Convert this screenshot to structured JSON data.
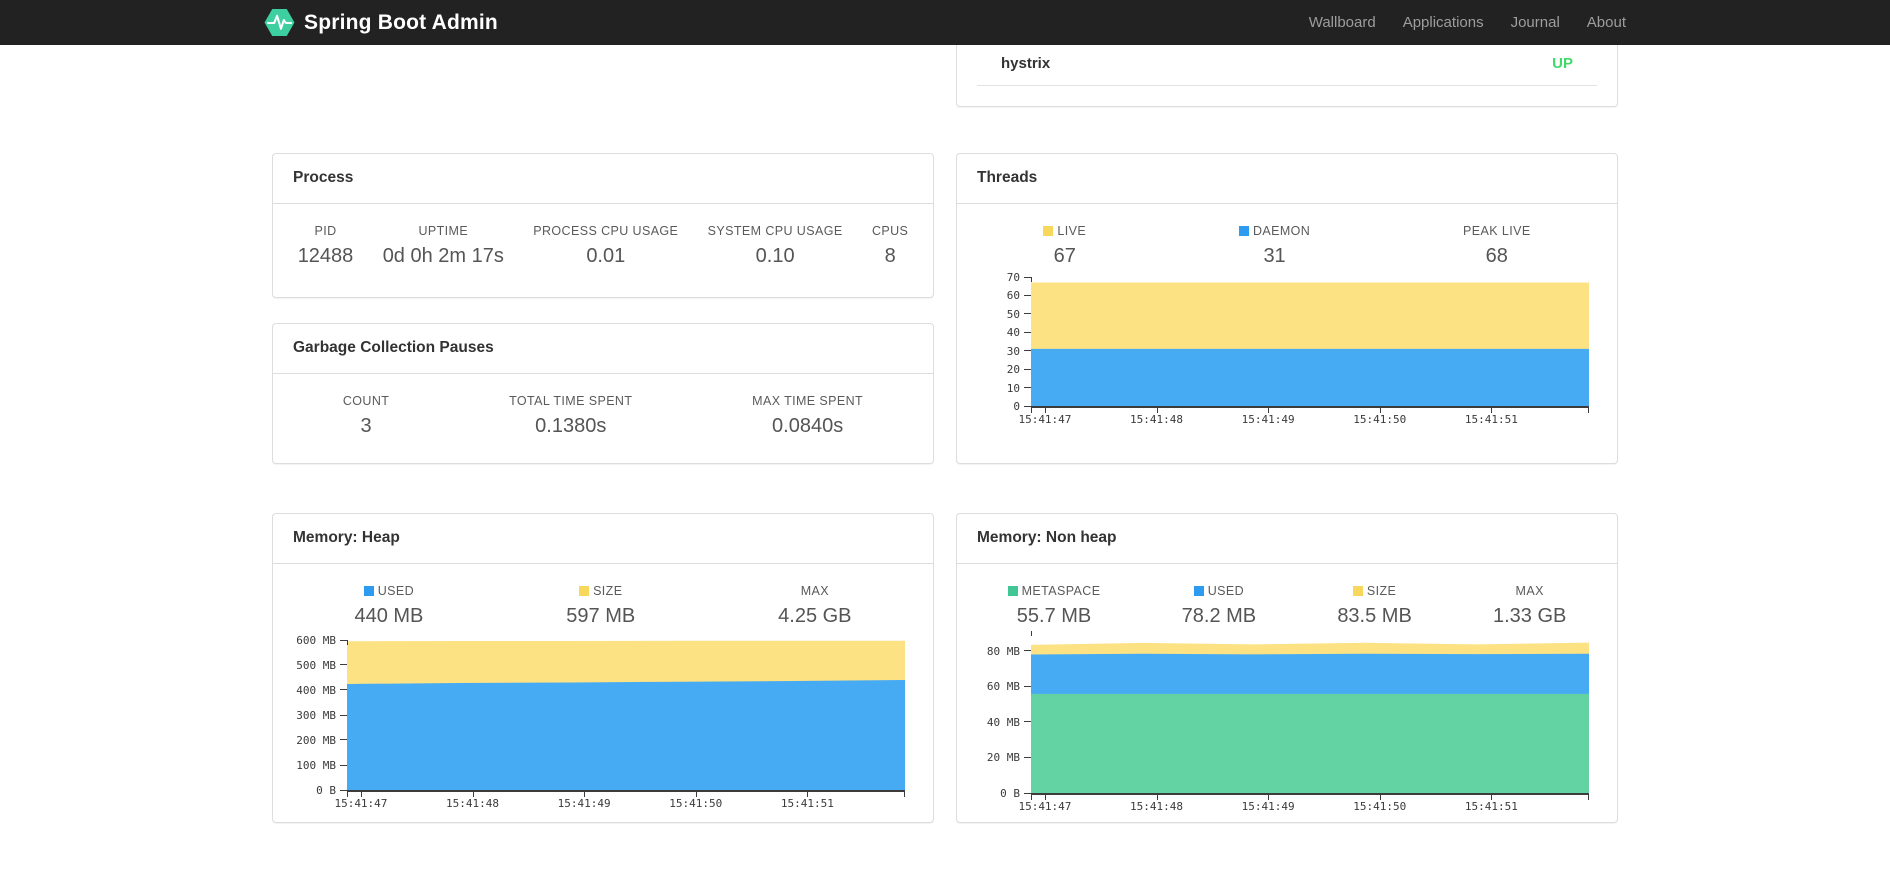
{
  "navbar": {
    "brand": "Spring Boot Admin",
    "links": [
      {
        "label": "Wallboard"
      },
      {
        "label": "Applications"
      },
      {
        "label": "Journal"
      },
      {
        "label": "About"
      }
    ]
  },
  "colors": {
    "navbar_bg": "#222222",
    "logo_green": "#3ecfa0",
    "status_up_green": "#42d96b",
    "area_yellow": "#fde284",
    "area_blue": "#47abf4",
    "area_green": "#64d3a4",
    "swatch_yellow": "#f8d75d",
    "swatch_blue": "#2d9bf0",
    "swatch_green": "#41c795",
    "panel_border": "#dddddd"
  },
  "health_panel": {
    "row_label": "hystrix",
    "row_status": "UP"
  },
  "panels": {
    "process": {
      "title": "Process",
      "stats": [
        {
          "label": "PID",
          "value": "12488"
        },
        {
          "label": "UPTIME",
          "value": "0d 0h 2m 17s"
        },
        {
          "label": "PROCESS CPU USAGE",
          "value": "0.01"
        },
        {
          "label": "SYSTEM CPU USAGE",
          "value": "0.10"
        },
        {
          "label": "CPUS",
          "value": "8"
        }
      ]
    },
    "gc": {
      "title": "Garbage Collection Pauses",
      "stats": [
        {
          "label": "COUNT",
          "value": "3"
        },
        {
          "label": "TOTAL TIME SPENT",
          "value": "0.1380s"
        },
        {
          "label": "MAX TIME SPENT",
          "value": "0.0840s"
        }
      ]
    },
    "threads": {
      "title": "Threads",
      "stats": [
        {
          "label": "LIVE",
          "value": "67",
          "swatch": "#f8d75d"
        },
        {
          "label": "DAEMON",
          "value": "31",
          "swatch": "#2d9bf0"
        },
        {
          "label": "PEAK LIVE",
          "value": "68"
        }
      ]
    },
    "heap": {
      "title": "Memory: Heap",
      "stats": [
        {
          "label": "USED",
          "value": "440 MB",
          "swatch": "#2d9bf0"
        },
        {
          "label": "SIZE",
          "value": "597 MB",
          "swatch": "#f8d75d"
        },
        {
          "label": "MAX",
          "value": "4.25 GB"
        }
      ]
    },
    "nonheap": {
      "title": "Memory: Non heap",
      "stats": [
        {
          "label": "METASPACE",
          "value": "55.7 MB",
          "swatch": "#41c795"
        },
        {
          "label": "USED",
          "value": "78.2 MB",
          "swatch": "#2d9bf0"
        },
        {
          "label": "SIZE",
          "value": "83.5 MB",
          "swatch": "#f8d75d"
        },
        {
          "label": "MAX",
          "value": "1.33 GB"
        }
      ]
    }
  },
  "chart_data": [
    {
      "id": "threads-chart",
      "type": "area",
      "title": "Threads",
      "ylim": [
        0,
        70
      ],
      "plot_max": 70,
      "yticks": [
        {
          "v": 0,
          "label": "0"
        },
        {
          "v": 10,
          "label": "10"
        },
        {
          "v": 20,
          "label": "20"
        },
        {
          "v": 30,
          "label": "30"
        },
        {
          "v": 40,
          "label": "40"
        },
        {
          "v": 50,
          "label": "50"
        },
        {
          "v": 60,
          "label": "60"
        },
        {
          "v": 70,
          "label": "70"
        }
      ],
      "xticks": [
        "15:41:47",
        "15:41:48",
        "15:41:49",
        "15:41:50",
        "15:41:51"
      ],
      "xtick_pct": [
        2.5,
        22.5,
        42.5,
        62.5,
        82.5
      ],
      "legend_position": "top",
      "grid": false,
      "series": [
        {
          "name": "LIVE",
          "color": "#fde284",
          "values": [
            67,
            67
          ]
        },
        {
          "name": "DAEMON",
          "color": "#47abf4",
          "values": [
            31,
            31
          ]
        }
      ]
    },
    {
      "id": "heap-chart",
      "type": "area",
      "title": "Memory: Heap",
      "ylim": [
        0,
        600
      ],
      "plot_max": 600,
      "yunit": "MB",
      "yticks": [
        {
          "v": 0,
          "label": "0 B"
        },
        {
          "v": 100,
          "label": "100 MB"
        },
        {
          "v": 200,
          "label": "200 MB"
        },
        {
          "v": 300,
          "label": "300 MB"
        },
        {
          "v": 400,
          "label": "400 MB"
        },
        {
          "v": 500,
          "label": "500 MB"
        },
        {
          "v": 600,
          "label": "600 MB"
        }
      ],
      "xticks": [
        "15:41:47",
        "15:41:48",
        "15:41:49",
        "15:41:50",
        "15:41:51"
      ],
      "xtick_pct": [
        2.5,
        22.5,
        42.5,
        62.5,
        82.5
      ],
      "legend_position": "top",
      "grid": false,
      "series": [
        {
          "name": "SIZE",
          "color": "#fde284",
          "values": [
            595,
            596,
            596,
            597,
            597,
            597
          ]
        },
        {
          "name": "USED",
          "color": "#47abf4",
          "values": [
            424,
            428,
            430,
            433,
            436,
            440
          ]
        }
      ]
    },
    {
      "id": "nonheap-chart",
      "type": "area",
      "title": "Memory: Non heap",
      "ylim": [
        0,
        91
      ],
      "plot_max": 91,
      "yunit": "MB",
      "yticks": [
        {
          "v": 0,
          "label": "0 B"
        },
        {
          "v": 20,
          "label": "20 MB"
        },
        {
          "v": 40,
          "label": "40 MB"
        },
        {
          "v": 60,
          "label": "60 MB"
        },
        {
          "v": 80,
          "label": "80 MB"
        }
      ],
      "xticks": [
        "15:41:47",
        "15:41:48",
        "15:41:49",
        "15:41:50",
        "15:41:51"
      ],
      "xtick_pct": [
        2.5,
        22.5,
        42.5,
        62.5,
        82.5
      ],
      "legend_position": "top",
      "grid": false,
      "series": [
        {
          "name": "SIZE",
          "color": "#fde284",
          "values": [
            83.2,
            84.3,
            83.5,
            84.4,
            83.5,
            84.5
          ]
        },
        {
          "name": "USED",
          "color": "#47abf4",
          "values": [
            77.8,
            78.2,
            77.9,
            78.2,
            78.0,
            78.2
          ]
        },
        {
          "name": "METASPACE",
          "color": "#64d3a4",
          "values": [
            55.7,
            55.7
          ]
        }
      ]
    }
  ]
}
